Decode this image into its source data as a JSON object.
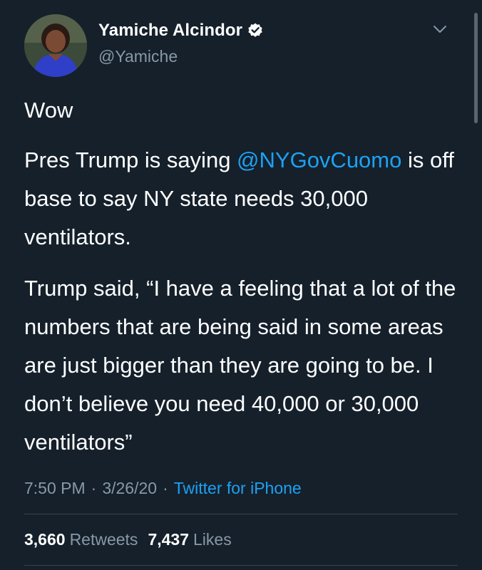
{
  "tweet": {
    "author": {
      "display_name": "Yamiche Alcindor",
      "handle": "@Yamiche",
      "verified_icon": "verified-badge-icon",
      "avatar_icon": "avatar"
    },
    "menu_icon": "chevron-down-icon",
    "paragraphs": {
      "p1": "Wow",
      "p2_before": "Pres Trump is saying ",
      "p2_mention": "@NYGovCuomo",
      "p2_after": " is off base to say NY state needs 30,000 ventilators.",
      "p3": "Trump said, “I have a feeling that a lot of the numbers that are being said in some areas are just bigger than they are going to be. I don’t believe you need 40,000 or 30,000 ventilators”"
    },
    "meta": {
      "time": "7:50 PM",
      "separator": "·",
      "date": "3/26/20",
      "source": "Twitter for iPhone"
    },
    "stats": {
      "retweets_count": "3,660",
      "retweets_label": "Retweets",
      "likes_count": "7,437",
      "likes_label": "Likes"
    }
  },
  "colors": {
    "background": "#15202b",
    "text": "#ffffff",
    "secondary_text": "#8899a6",
    "link": "#1da1f2",
    "divider": "#38444d"
  }
}
